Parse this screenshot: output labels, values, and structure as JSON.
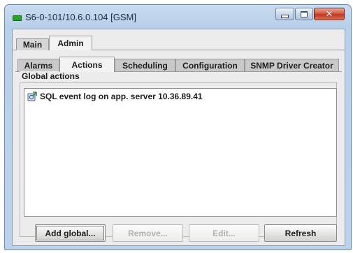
{
  "window": {
    "title": "S6-0-101/10.6.0.104 [GSM]",
    "status_color": "#22a32a",
    "controls": {
      "minimize_icon": "minimize-icon",
      "maximize_icon": "maximize-icon",
      "close_icon": "close-icon",
      "close_glyph": "✕"
    }
  },
  "outer_tabs": [
    {
      "label": "Main",
      "selected": false
    },
    {
      "label": "Admin",
      "selected": true
    }
  ],
  "inner_tabs": [
    {
      "label": "Alarms",
      "selected": false
    },
    {
      "label": "Actions",
      "selected": true
    },
    {
      "label": "Scheduling",
      "selected": false
    },
    {
      "label": "Configuration",
      "selected": false
    },
    {
      "label": "SNMP Driver Creator",
      "selected": false
    }
  ],
  "global_actions": {
    "title": "Global actions",
    "items": [
      {
        "label": "SQL event log on app. server 10.36.89.41",
        "icon": "action-icon"
      }
    ]
  },
  "buttons": {
    "add": "Add global...",
    "remove": "Remove...",
    "edit": "Edit...",
    "refresh": "Refresh"
  }
}
